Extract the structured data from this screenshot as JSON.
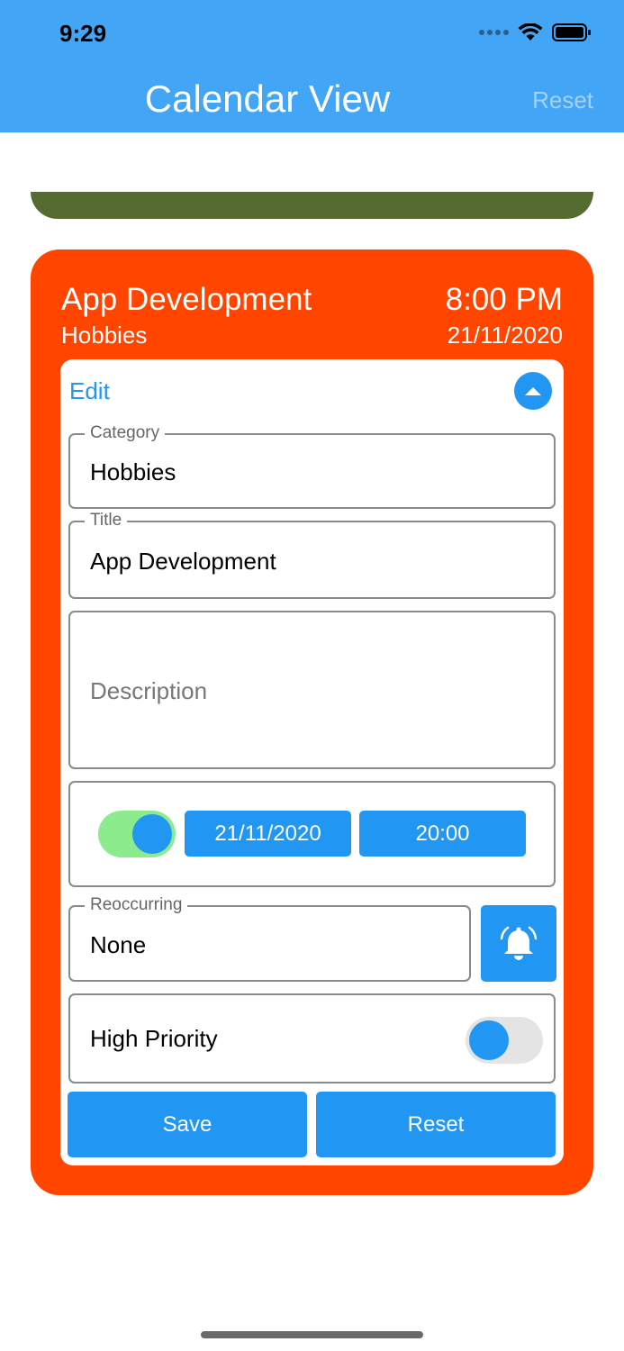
{
  "status_bar": {
    "time": "9:29"
  },
  "nav": {
    "title": "Calendar View",
    "reset_label": "Reset"
  },
  "event": {
    "title": "App Development",
    "category": "Hobbies",
    "time": "8:00 PM",
    "date": "21/11/2020"
  },
  "form": {
    "edit_label": "Edit",
    "category": {
      "legend": "Category",
      "value": "Hobbies"
    },
    "title": {
      "legend": "Title",
      "value": "App Development"
    },
    "description": {
      "placeholder": "Description",
      "value": ""
    },
    "schedule": {
      "enabled": true,
      "date": "21/11/2020",
      "time": "20:00"
    },
    "reoccurring": {
      "legend": "Reoccurring",
      "value": "None"
    },
    "priority": {
      "label": "High Priority",
      "enabled": false
    },
    "save_label": "Save",
    "reset_label": "Reset"
  },
  "colors": {
    "app_bar": "#42a5f5",
    "card": "#ff4500",
    "prev_card": "#556b2f",
    "accent": "#2196f3",
    "toggle_on_track": "#8ceb8c"
  },
  "icons": {
    "status": [
      "signal-icon",
      "wifi-icon",
      "battery-icon"
    ],
    "collapse": "chevron-up-icon",
    "alarm": "alarm-bell-icon"
  }
}
